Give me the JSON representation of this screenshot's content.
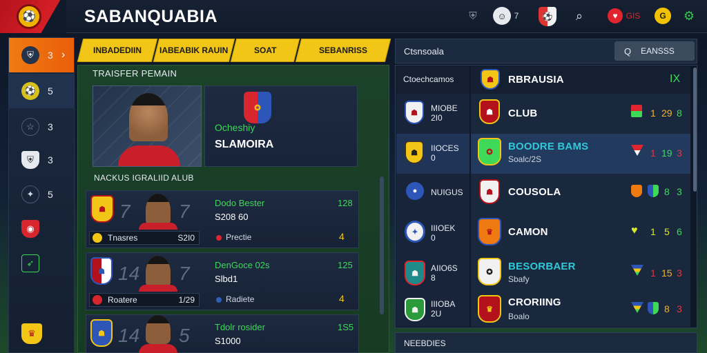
{
  "header": {
    "title": "SABANQUABIA",
    "avatar_count": "7",
    "alert_text": "GIS",
    "coin_symbol": "G",
    "icons": [
      "app-logo-icon",
      "shield-icon",
      "avatar-icon",
      "club-crest-icon",
      "search-icon",
      "alert-icon",
      "coin-icon",
      "settings-icon"
    ]
  },
  "sidebar": {
    "items": [
      {
        "icon": "crest-icon",
        "count": "3",
        "active": true
      },
      {
        "icon": "ball-icon",
        "count": "5"
      },
      {
        "icon": "star-icon",
        "count": "3"
      },
      {
        "icon": "shield-icon",
        "count": "3"
      },
      {
        "icon": "handshake-icon",
        "count": "5"
      },
      {
        "icon": "club-crest-icon",
        "count": ""
      },
      {
        "icon": "boot-icon",
        "count": ""
      },
      {
        "icon": "trophy-crest-icon",
        "count": ""
      }
    ]
  },
  "tabs": [
    "INBADEDIIN",
    "IABEABIK RAUIN",
    "SOAT",
    "SEBANRISS"
  ],
  "transfer": {
    "section_title": "TRAISFER PEMAIN",
    "hero_club": "Ocheshiy",
    "hero_name": "SLAMOIRA",
    "list_title": "NACKUS IGRALIID ALUB",
    "players": [
      {
        "number": "7",
        "name": "Dodo Bester",
        "price": "S208 60",
        "rating": "128",
        "club_label": "Tnasres",
        "club_value": "S2I0",
        "status": "Prectie",
        "status_color": "#e0252e",
        "stat": "4"
      },
      {
        "number": "7",
        "name": "DenGoce 02s",
        "price": "Slbd1",
        "rating": "125",
        "club_label": "Roatere",
        "club_value": "1/29",
        "status": "Radiete",
        "status_color": "#2f5fb8",
        "stat": "4"
      },
      {
        "number": "5",
        "name": "Tdolr rosider",
        "price": "S1000",
        "rating": "1S5",
        "club_label": "",
        "club_value": "",
        "status": "",
        "status_color": "",
        "stat": ""
      }
    ]
  },
  "clubs": {
    "header_label": "Ctsnsoala",
    "search_placeholder": "EANSSS",
    "col_left": "Ctoechcamos",
    "col_right": "RBRAUSIA",
    "close_label": "IX",
    "rows": [
      {
        "code": "MIOBE",
        "sub": "2I0",
        "name": "CLUB",
        "name_sub": "",
        "teal": false,
        "v1": "1",
        "v2": "29",
        "v3": "8",
        "highlight": false
      },
      {
        "code": "IIOCES",
        "sub": "0",
        "name": "BOODRE BAMS",
        "name_sub": "Soalc/2S",
        "teal": true,
        "v1": "1",
        "v2": "19",
        "v3": "3",
        "highlight": true
      },
      {
        "code": "NUIGUS",
        "sub": "",
        "name": "COUSOLA",
        "name_sub": "",
        "teal": false,
        "v1": "",
        "v2": "8",
        "v3": "3",
        "highlight": false
      },
      {
        "code": "IIIOEK",
        "sub": "0",
        "name": "CAMON",
        "name_sub": "",
        "teal": false,
        "v1": "1",
        "v2": "5",
        "v3": "6",
        "highlight": false
      },
      {
        "code": "AIIO6S",
        "sub": "8",
        "name": "BESORBAER",
        "name_sub": "Sbafy",
        "teal": true,
        "v1": "1",
        "v2": "15",
        "v3": "3",
        "highlight": false
      },
      {
        "code": "IIIOBA",
        "sub": "2U",
        "name": "CRORIING",
        "name_sub": "Boalo",
        "teal": false,
        "v1": "",
        "v2": "8",
        "v3": "3",
        "highlight": false
      }
    ],
    "footer_label": "NEEBDIES"
  },
  "colors": {
    "accent_orange": "#f07a12",
    "tab_yellow": "#f2c617",
    "stat_green": "#3fd95a",
    "stat_orange": "#f5b326",
    "stat_red": "#e8343c",
    "teal": "#31c8d8"
  }
}
